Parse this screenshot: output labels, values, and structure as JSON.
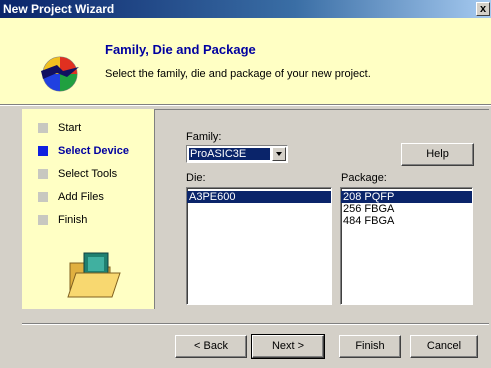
{
  "window": {
    "title": "New Project Wizard",
    "close_label": "x"
  },
  "header": {
    "title": "Family, Die and Package",
    "subtitle": "Select the family, die and package of your new project."
  },
  "steps": [
    {
      "label": "Start",
      "active": false
    },
    {
      "label": "Select Device",
      "active": true
    },
    {
      "label": "Select Tools",
      "active": false
    },
    {
      "label": "Add Files",
      "active": false
    },
    {
      "label": "Finish",
      "active": false
    }
  ],
  "device": {
    "family_label": "Family:",
    "family_value": "ProASIC3E",
    "help_label": "Help",
    "die_label": "Die:",
    "die_items": [
      "A3PE600"
    ],
    "die_selected": "A3PE600",
    "package_label": "Package:",
    "package_items": [
      "208 PQFP",
      "256 FBGA",
      "484 FBGA"
    ],
    "package_selected": "208 PQFP"
  },
  "buttons": {
    "back": "< Back",
    "next": "Next >",
    "finish": "Finish",
    "cancel": "Cancel"
  },
  "colors": {
    "title_bar": "#0a246a",
    "panel_bg": "#ffffc4",
    "accent_text": "#0000a0",
    "active_step": "#1020e0"
  }
}
